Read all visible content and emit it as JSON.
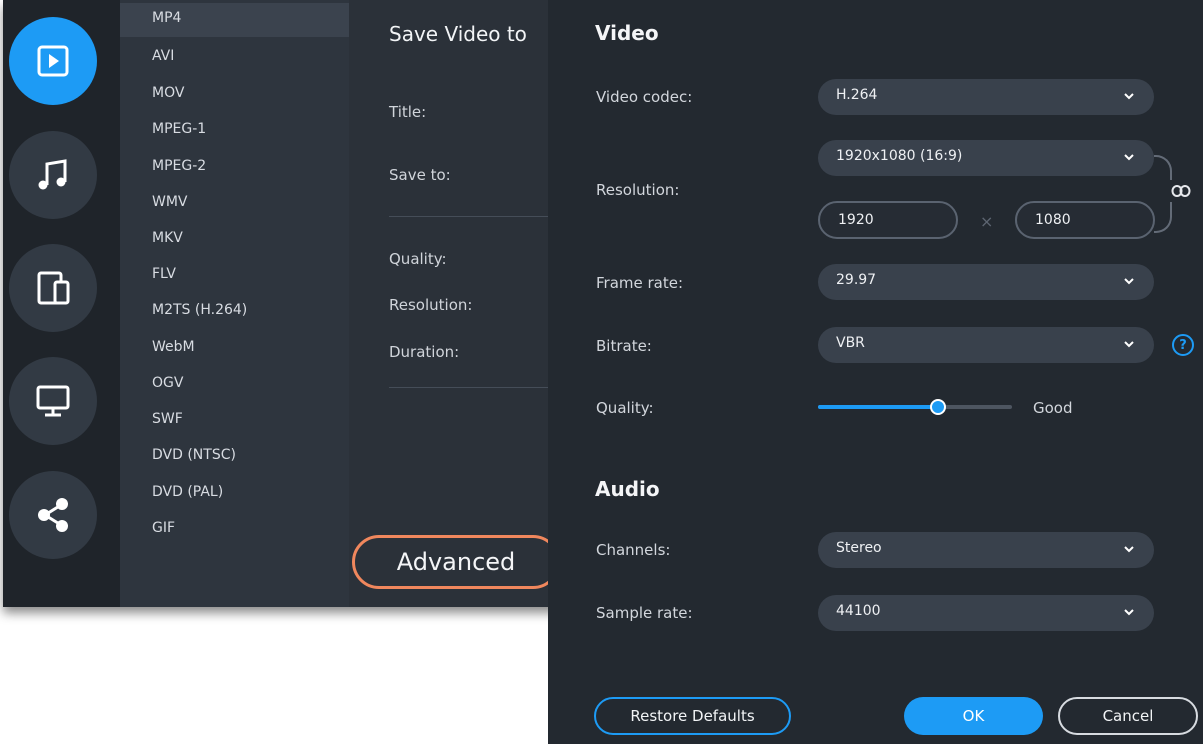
{
  "formats": [
    "MP4",
    "AVI",
    "MOV",
    "MPEG-1",
    "MPEG-2",
    "WMV",
    "MKV",
    "FLV",
    "M2TS (H.264)",
    "WebM",
    "OGV",
    "SWF",
    "DVD (NTSC)",
    "DVD (PAL)",
    "GIF"
  ],
  "selected_format": "MP4",
  "categories": [
    "video-icon",
    "music-icon",
    "devices-icon",
    "monitor-icon",
    "share-icon"
  ],
  "export_pane": {
    "title": "Save Video to",
    "title_label": "Title:",
    "save_to_label": "Save to:",
    "quality_label": "Quality:",
    "resolution_label": "Resolution:",
    "duration_label": "Duration:",
    "advanced_button": "Advanced"
  },
  "advanced": {
    "video_title": "Video",
    "video_codec_label": "Video codec:",
    "video_codec": "H.264",
    "resolution_label": "Resolution:",
    "resolution_preset": "1920x1080 (16:9)",
    "width": "1920",
    "height": "1080",
    "times_sign": "×",
    "frame_rate_label": "Frame rate:",
    "frame_rate": "29.97",
    "bitrate_label": "Bitrate:",
    "bitrate": "VBR",
    "quality_label": "Quality:",
    "quality_value": "Good",
    "quality_level": 0.62,
    "audio_title": "Audio",
    "channels_label": "Channels:",
    "channels": "Stereo",
    "sample_rate_label": "Sample rate:",
    "sample_rate": "44100",
    "restore_button": "Restore Defaults",
    "ok_button": "OK",
    "cancel_button": "Cancel",
    "help_glyph": "?"
  },
  "colors": {
    "accent": "#1d9bf5",
    "highlight": "#f0875d"
  }
}
